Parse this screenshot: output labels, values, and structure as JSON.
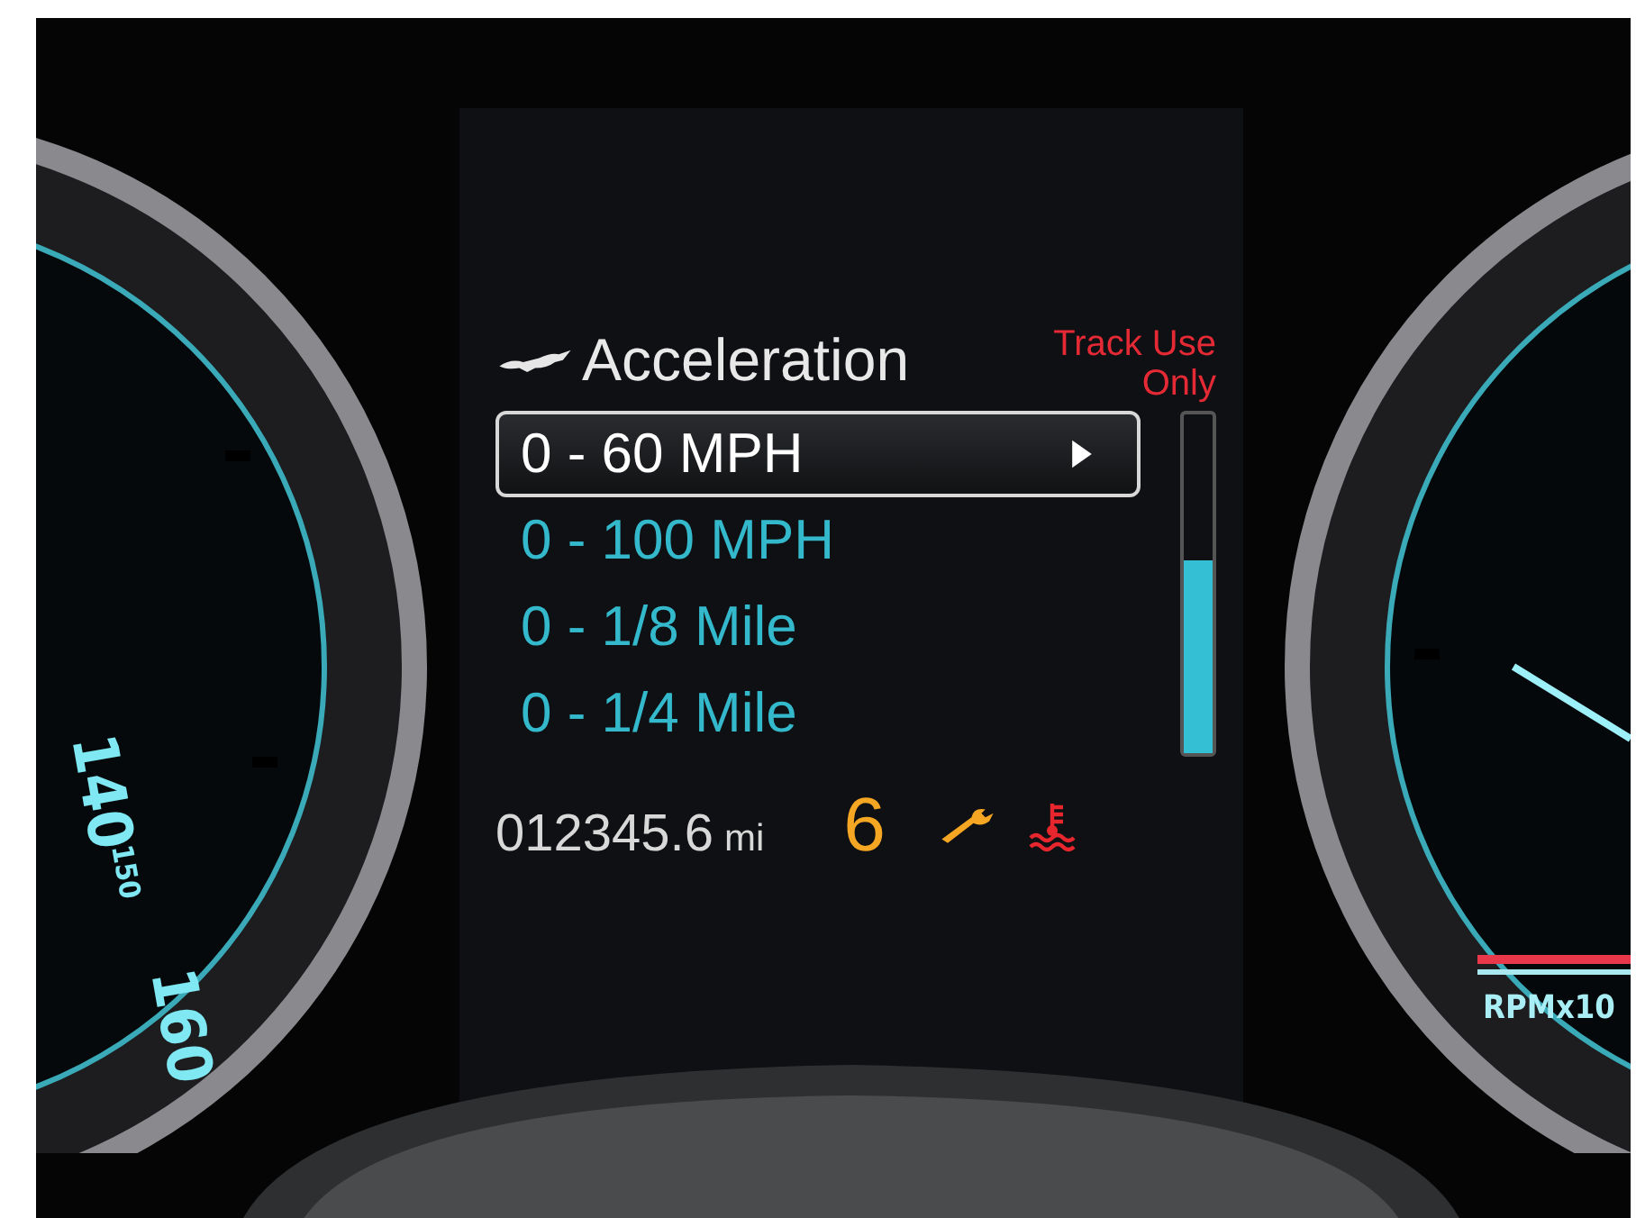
{
  "left_gauge": {
    "labels": [
      "140",
      "150",
      "160"
    ]
  },
  "display": {
    "title": "Acceleration",
    "warning": "Track Use Only",
    "menu": [
      {
        "label": "0 - 60 MPH",
        "selected": true
      },
      {
        "label": "0 - 100 MPH",
        "selected": false
      },
      {
        "label": "0 - 1/8 Mile",
        "selected": false
      },
      {
        "label": "0 - 1/4 Mile",
        "selected": false
      }
    ],
    "track_meter": {
      "level": 0.57
    },
    "odometer": {
      "value": "012345.6",
      "unit": "mi"
    },
    "gear": "6"
  },
  "right_gauge": {
    "label": "RPMx10"
  }
}
